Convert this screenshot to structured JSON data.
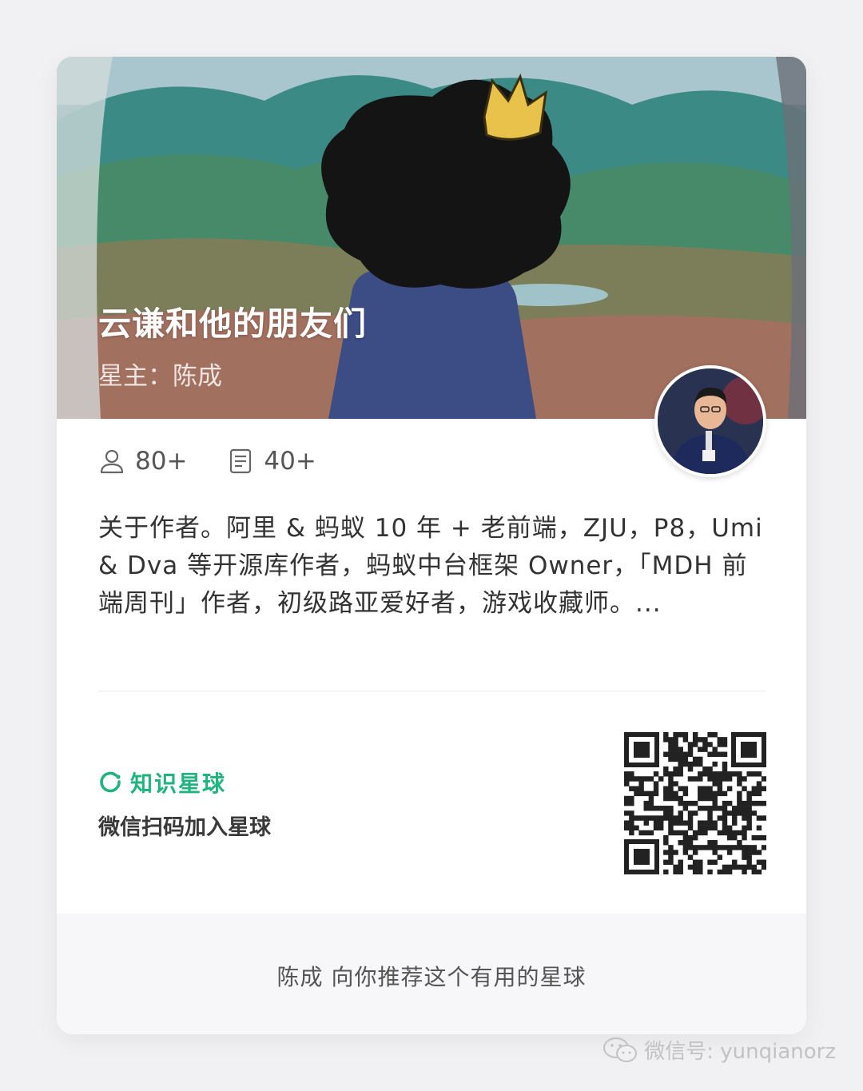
{
  "card": {
    "title": "云谦和他的朋友们",
    "owner": "星主：陈成",
    "stats": {
      "members": "80+",
      "topics": "40+"
    },
    "description": "关于作者。阿里 & 蚂蚁 10 年 + 老前端，ZJU，P8，Umi & Dva 等开源库作者，蚂蚁中台框架 Owner，「MDH 前端周刊」作者，初级路亚爱好者，游戏收藏师。...",
    "brand": "知识星球",
    "join_text": "微信扫码加入星球",
    "footer": "陈成 向你推荐这个有用的星球"
  },
  "watermark": "微信号: yunqianorz",
  "colors": {
    "brand": "#1fb37e",
    "background": "#f1f1f3",
    "footer_bg": "#f7f7f9"
  },
  "icons": {
    "members": "person-icon",
    "topics": "document-icon",
    "brand": "planet-ring-icon",
    "watermark": "wechat-icon"
  }
}
